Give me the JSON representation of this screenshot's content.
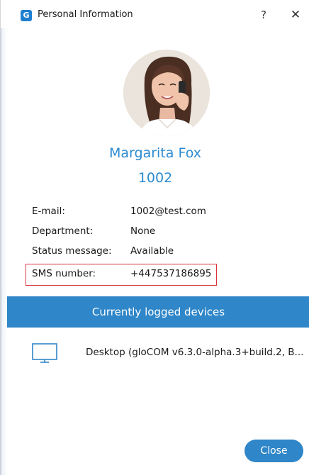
{
  "window": {
    "title": "Personal Information",
    "app_icon_letter": "G",
    "help_label": "?",
    "close_label": "✕"
  },
  "profile": {
    "name": "Margarita Fox",
    "extension": "1002"
  },
  "info": [
    {
      "label": "E-mail:",
      "value": "1002@test.com"
    },
    {
      "label": "Department:",
      "value": "None"
    },
    {
      "label": "Status message:",
      "value": "Available"
    },
    {
      "label": "SMS number:",
      "value": "+447537186895"
    }
  ],
  "devices": {
    "header": "Currently logged devices",
    "items": [
      {
        "icon": "desktop-monitor-icon",
        "label": "Desktop (gloCOM v6.3.0-alpha.3+build.2, B..."
      }
    ]
  },
  "footer": {
    "close_button": "Close"
  },
  "colors": {
    "accent": "#2f86c8",
    "name_text": "#2b8ad0",
    "highlight_border": "#d9343a"
  }
}
